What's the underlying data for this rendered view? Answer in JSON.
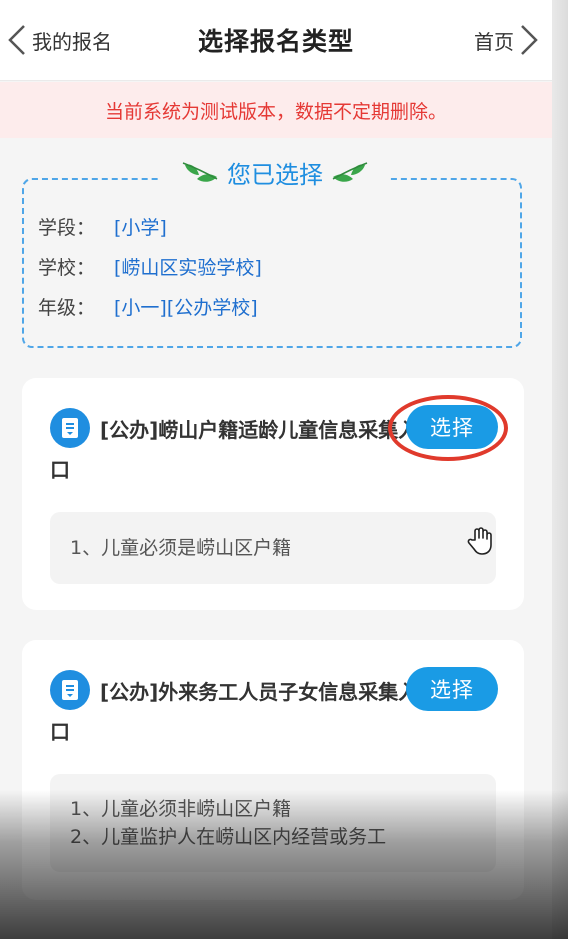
{
  "header": {
    "back_label": "我的报名",
    "title": "选择报名类型",
    "home_label": "首页"
  },
  "notice": "当前系统为测试版本，数据不定期删除。",
  "selected": {
    "heading": "您已选择",
    "rows": [
      {
        "key": "学段：",
        "value": "[小学]"
      },
      {
        "key": "学校：",
        "value": "[崂山区实验学校]"
      },
      {
        "key": "年级：",
        "value": "[小一][公办学校]"
      }
    ]
  },
  "options": [
    {
      "title": "[公办]崂山户籍适龄儿童信息采集入口",
      "button": "选择",
      "requirements": [
        "1、儿童必须是崂山区户籍"
      ]
    },
    {
      "title": "[公办]外来务工人员子女信息采集入口",
      "button": "选择",
      "requirements": [
        "1、儿童必须非崂山区户籍",
        "2、儿童监护人在崂山区内经营或务工"
      ]
    }
  ],
  "colors": {
    "accent": "#1a9be5",
    "notice_text": "#e53935",
    "notice_bg": "#fdecec",
    "highlight": "#e03a2c"
  },
  "icons": {
    "back": "chevron-left-icon",
    "home": "chevron-right-icon",
    "card": "bookmark-icon",
    "leaf": "leaf-icon",
    "cursor": "hand-cursor-icon"
  }
}
